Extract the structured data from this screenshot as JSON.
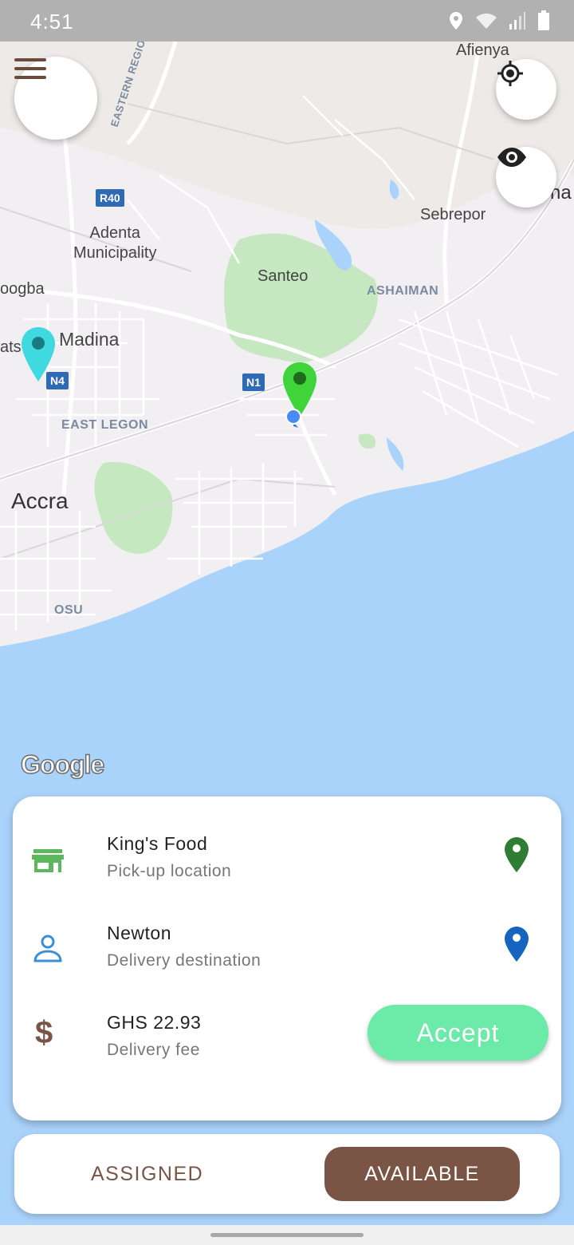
{
  "status_bar": {
    "time": "4:51"
  },
  "map": {
    "labels": {
      "afienya": "Afienya",
      "eastern_region": "EASTERN REGION",
      "r40": "R40",
      "adenta": "Adenta\nMunicipality",
      "sebrepor": "Sebrepor",
      "santeo": "Santeo",
      "ashaiman": "ASHAIMAN",
      "oogba": "oogba",
      "madina": "Madina",
      "ats": "ats",
      "n4": "N4",
      "n1": "N1",
      "east_legon": "EAST LEGON",
      "accra": "Accra",
      "osu": "OSU",
      "na": "na"
    },
    "google_logo": "Google"
  },
  "order": {
    "pickup": {
      "name": "King's Food",
      "label": "Pick-up location"
    },
    "destination": {
      "name": "Newton",
      "label": "Delivery destination"
    },
    "fee": {
      "amount": "GHS 22.93",
      "label": "Delivery fee"
    },
    "accept_label": "Accept"
  },
  "tabs": {
    "assigned": "ASSIGNED",
    "available": "AVAILABLE"
  },
  "colors": {
    "brown": "#7a5546",
    "accept": "#6ceaa8",
    "pickup_pin": "#2e7d32",
    "dest_pin": "#1565c0",
    "store_icon": "#5cb85c",
    "person_icon": "#3b8fd6"
  }
}
